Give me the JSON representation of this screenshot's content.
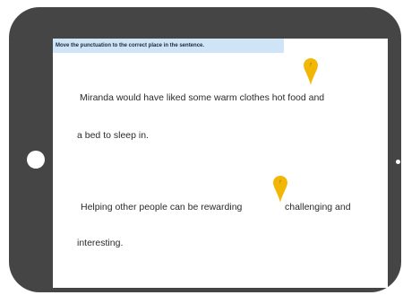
{
  "instruction": "Move the punctuation to the correct place in the sentence.",
  "sentences": [
    {
      "line1": "Miranda would have liked some warm clothes hot food and",
      "line2": "a bed to sleep in."
    },
    {
      "line1": "Helping other people can be rewarding",
      "line1_rest": "challenging and",
      "line2": "interesting."
    }
  ],
  "colors": {
    "device": "#454545",
    "instruction_bg": "#cfe4f7",
    "pin": "#f2b705"
  },
  "icons": [
    "map-pin-icon",
    "map-pin-icon"
  ]
}
